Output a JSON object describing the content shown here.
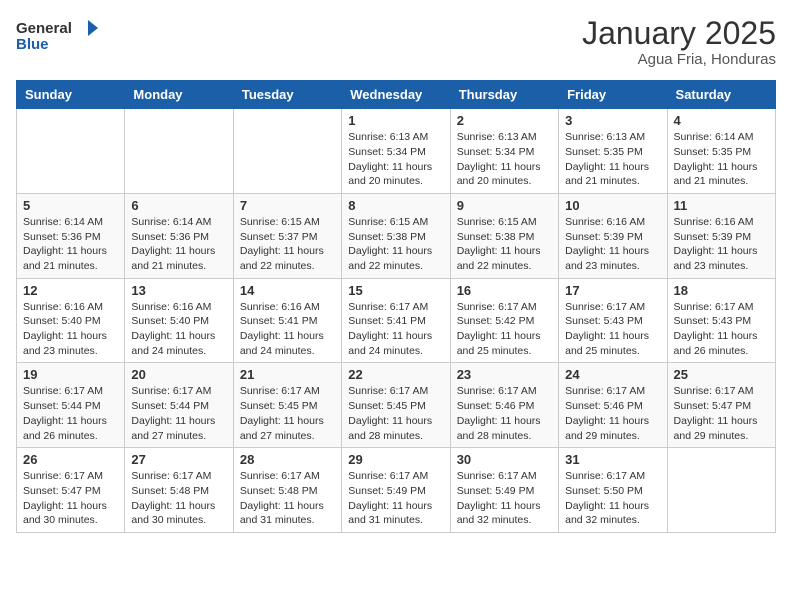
{
  "header": {
    "logo_general": "General",
    "logo_blue": "Blue",
    "month": "January 2025",
    "location": "Agua Fria, Honduras"
  },
  "weekdays": [
    "Sunday",
    "Monday",
    "Tuesday",
    "Wednesday",
    "Thursday",
    "Friday",
    "Saturday"
  ],
  "weeks": [
    [
      {
        "day": "",
        "info": ""
      },
      {
        "day": "",
        "info": ""
      },
      {
        "day": "",
        "info": ""
      },
      {
        "day": "1",
        "info": "Sunrise: 6:13 AM\nSunset: 5:34 PM\nDaylight: 11 hours\nand 20 minutes."
      },
      {
        "day": "2",
        "info": "Sunrise: 6:13 AM\nSunset: 5:34 PM\nDaylight: 11 hours\nand 20 minutes."
      },
      {
        "day": "3",
        "info": "Sunrise: 6:13 AM\nSunset: 5:35 PM\nDaylight: 11 hours\nand 21 minutes."
      },
      {
        "day": "4",
        "info": "Sunrise: 6:14 AM\nSunset: 5:35 PM\nDaylight: 11 hours\nand 21 minutes."
      }
    ],
    [
      {
        "day": "5",
        "info": "Sunrise: 6:14 AM\nSunset: 5:36 PM\nDaylight: 11 hours\nand 21 minutes."
      },
      {
        "day": "6",
        "info": "Sunrise: 6:14 AM\nSunset: 5:36 PM\nDaylight: 11 hours\nand 21 minutes."
      },
      {
        "day": "7",
        "info": "Sunrise: 6:15 AM\nSunset: 5:37 PM\nDaylight: 11 hours\nand 22 minutes."
      },
      {
        "day": "8",
        "info": "Sunrise: 6:15 AM\nSunset: 5:38 PM\nDaylight: 11 hours\nand 22 minutes."
      },
      {
        "day": "9",
        "info": "Sunrise: 6:15 AM\nSunset: 5:38 PM\nDaylight: 11 hours\nand 22 minutes."
      },
      {
        "day": "10",
        "info": "Sunrise: 6:16 AM\nSunset: 5:39 PM\nDaylight: 11 hours\nand 23 minutes."
      },
      {
        "day": "11",
        "info": "Sunrise: 6:16 AM\nSunset: 5:39 PM\nDaylight: 11 hours\nand 23 minutes."
      }
    ],
    [
      {
        "day": "12",
        "info": "Sunrise: 6:16 AM\nSunset: 5:40 PM\nDaylight: 11 hours\nand 23 minutes."
      },
      {
        "day": "13",
        "info": "Sunrise: 6:16 AM\nSunset: 5:40 PM\nDaylight: 11 hours\nand 24 minutes."
      },
      {
        "day": "14",
        "info": "Sunrise: 6:16 AM\nSunset: 5:41 PM\nDaylight: 11 hours\nand 24 minutes."
      },
      {
        "day": "15",
        "info": "Sunrise: 6:17 AM\nSunset: 5:41 PM\nDaylight: 11 hours\nand 24 minutes."
      },
      {
        "day": "16",
        "info": "Sunrise: 6:17 AM\nSunset: 5:42 PM\nDaylight: 11 hours\nand 25 minutes."
      },
      {
        "day": "17",
        "info": "Sunrise: 6:17 AM\nSunset: 5:43 PM\nDaylight: 11 hours\nand 25 minutes."
      },
      {
        "day": "18",
        "info": "Sunrise: 6:17 AM\nSunset: 5:43 PM\nDaylight: 11 hours\nand 26 minutes."
      }
    ],
    [
      {
        "day": "19",
        "info": "Sunrise: 6:17 AM\nSunset: 5:44 PM\nDaylight: 11 hours\nand 26 minutes."
      },
      {
        "day": "20",
        "info": "Sunrise: 6:17 AM\nSunset: 5:44 PM\nDaylight: 11 hours\nand 27 minutes."
      },
      {
        "day": "21",
        "info": "Sunrise: 6:17 AM\nSunset: 5:45 PM\nDaylight: 11 hours\nand 27 minutes."
      },
      {
        "day": "22",
        "info": "Sunrise: 6:17 AM\nSunset: 5:45 PM\nDaylight: 11 hours\nand 28 minutes."
      },
      {
        "day": "23",
        "info": "Sunrise: 6:17 AM\nSunset: 5:46 PM\nDaylight: 11 hours\nand 28 minutes."
      },
      {
        "day": "24",
        "info": "Sunrise: 6:17 AM\nSunset: 5:46 PM\nDaylight: 11 hours\nand 29 minutes."
      },
      {
        "day": "25",
        "info": "Sunrise: 6:17 AM\nSunset: 5:47 PM\nDaylight: 11 hours\nand 29 minutes."
      }
    ],
    [
      {
        "day": "26",
        "info": "Sunrise: 6:17 AM\nSunset: 5:47 PM\nDaylight: 11 hours\nand 30 minutes."
      },
      {
        "day": "27",
        "info": "Sunrise: 6:17 AM\nSunset: 5:48 PM\nDaylight: 11 hours\nand 30 minutes."
      },
      {
        "day": "28",
        "info": "Sunrise: 6:17 AM\nSunset: 5:48 PM\nDaylight: 11 hours\nand 31 minutes."
      },
      {
        "day": "29",
        "info": "Sunrise: 6:17 AM\nSunset: 5:49 PM\nDaylight: 11 hours\nand 31 minutes."
      },
      {
        "day": "30",
        "info": "Sunrise: 6:17 AM\nSunset: 5:49 PM\nDaylight: 11 hours\nand 32 minutes."
      },
      {
        "day": "31",
        "info": "Sunrise: 6:17 AM\nSunset: 5:50 PM\nDaylight: 11 hours\nand 32 minutes."
      },
      {
        "day": "",
        "info": ""
      }
    ]
  ]
}
